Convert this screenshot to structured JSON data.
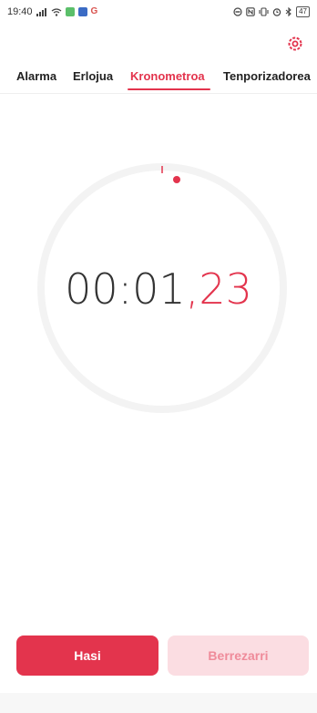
{
  "status_bar": {
    "time": "19:40",
    "battery": "47"
  },
  "header": {
    "settings_icon": "settings-ring-icon"
  },
  "tabs": [
    {
      "label": "Alarma",
      "active": false
    },
    {
      "label": "Erlojua",
      "active": false
    },
    {
      "label": "Kronometroa",
      "active": true
    },
    {
      "label": "Tenporizadorea",
      "active": false
    }
  ],
  "stopwatch": {
    "time_main": "00:01",
    "time_centis": ",23"
  },
  "buttons": {
    "start_label": "Hasi",
    "reset_label": "Berrezarri"
  },
  "colors": {
    "accent": "#e3344d",
    "accent_light": "#fbdde2",
    "ring": "#f2f2f2"
  }
}
